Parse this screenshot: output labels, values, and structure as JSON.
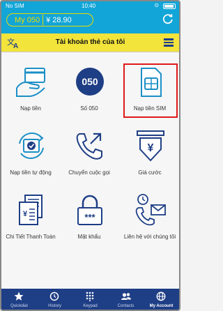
{
  "status_bar": {
    "carrier": "No SIM",
    "time": "10:40"
  },
  "header": {
    "account": "My 050",
    "balance": "¥ 28.90",
    "refresh_icon": "refresh-icon"
  },
  "titlebar": {
    "title": "Tài khoản thẻ của tôi",
    "language_icon": "translate-icon",
    "menu_icon": "hamburger-menu-icon"
  },
  "grid": {
    "tiles": [
      {
        "label": "Nạp tiền",
        "icon": "card-hand-icon"
      },
      {
        "label": "Số 050",
        "icon": "050-logo-icon"
      },
      {
        "label": "Nạp tiền SIM",
        "icon": "sim-card-icon"
      },
      {
        "label": "Nạp tiền tự động",
        "icon": "auto-topup-icon"
      },
      {
        "label": "Chuyển cuộc gọi",
        "icon": "call-forward-icon"
      },
      {
        "label": "Giá cước",
        "icon": "yen-price-icon"
      },
      {
        "label": "Chi Tiết Thanh Toán",
        "icon": "invoice-icon"
      },
      {
        "label": "Mật khẩu",
        "icon": "password-lock-icon"
      },
      {
        "label": "Liên hệ với chúng tôi",
        "icon": "contact-icon"
      }
    ]
  },
  "tabbar": {
    "tabs": [
      {
        "label": "Quickdial",
        "icon": "star-icon"
      },
      {
        "label": "History",
        "icon": "clock-icon"
      },
      {
        "label": "Keypad",
        "icon": "keypad-icon"
      },
      {
        "label": "Contacts",
        "icon": "contacts-icon"
      },
      {
        "label": "My Account",
        "icon": "globe-icon"
      }
    ],
    "active": "My Account"
  },
  "colors": {
    "header_blue": "#12a5d7",
    "title_yellow": "#f3e43b",
    "tab_navy": "#1e3e85",
    "highlight_red": "#e01818"
  }
}
